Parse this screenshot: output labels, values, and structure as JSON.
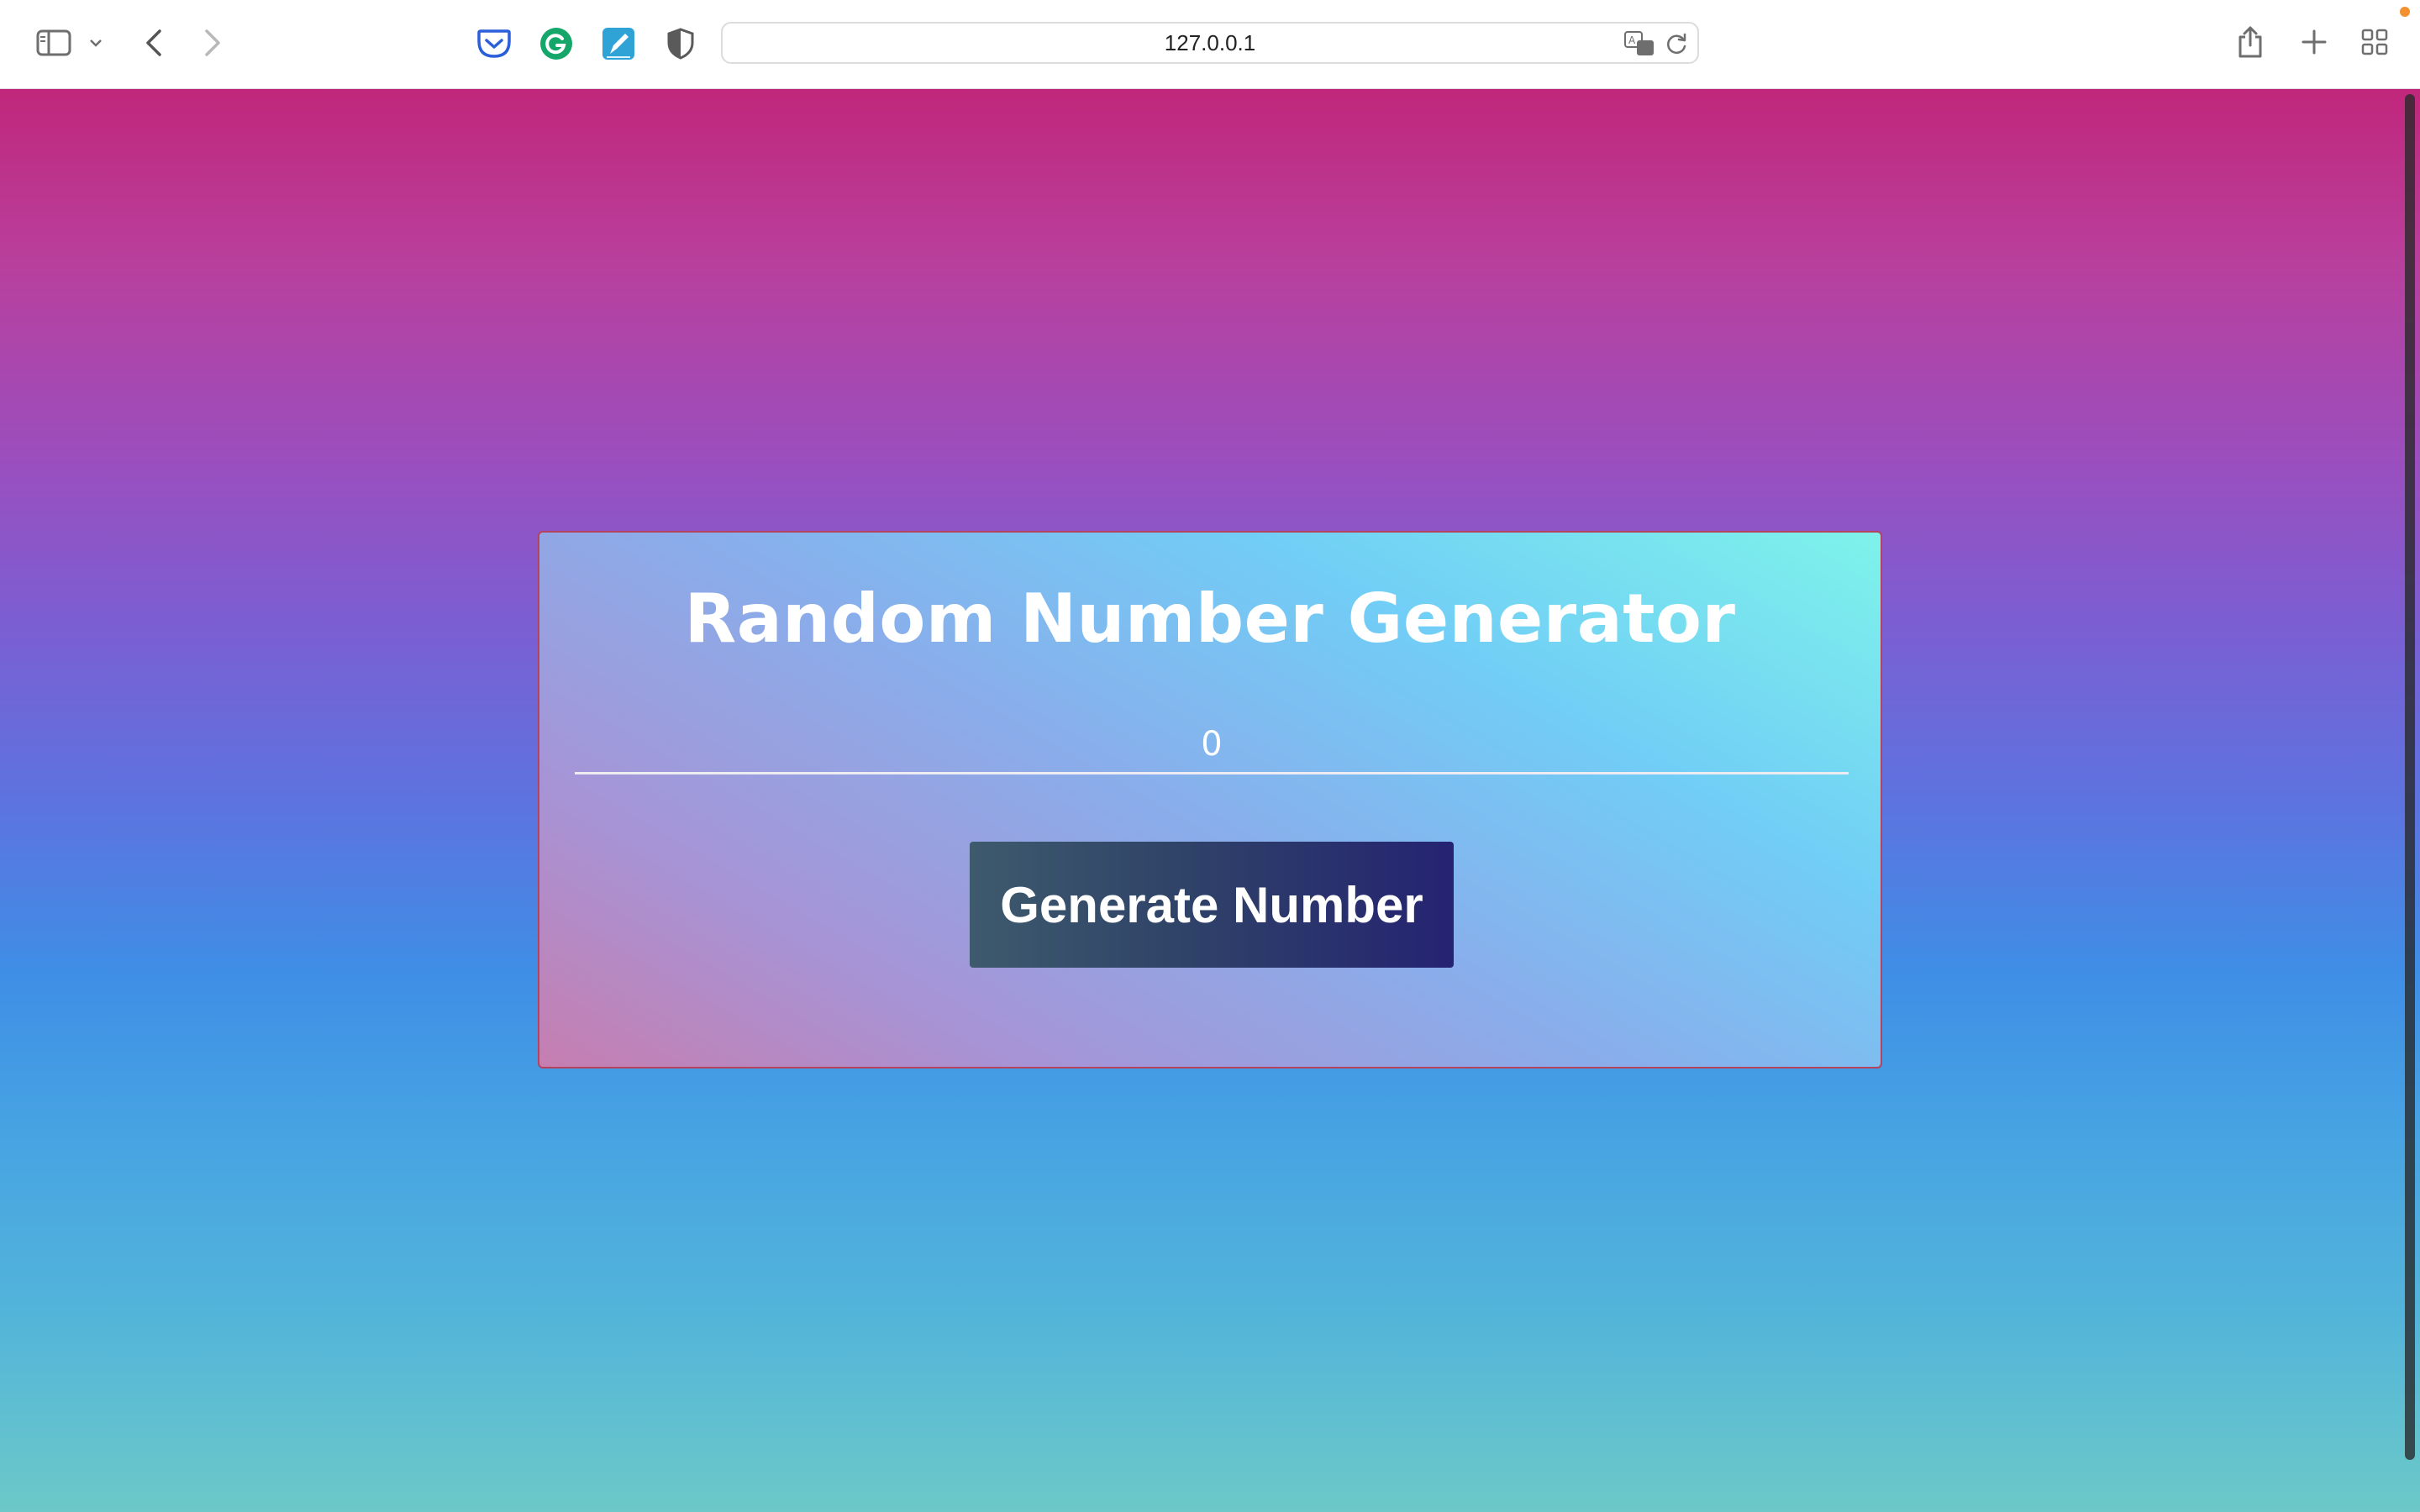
{
  "browser": {
    "url": "127.0.0.1",
    "extensions": [
      "pocket-icon",
      "grammarly-icon",
      "pen-icon",
      "shield-icon"
    ],
    "accent_dot_color": "#f3902f"
  },
  "app": {
    "title": "Random Number Generator",
    "number_value": "0",
    "button_label": "Generate Number"
  },
  "colors": {
    "page_gradient_top": "#c0277b",
    "page_gradient_bottom": "#6cc9c8",
    "card_border": "#b5435e",
    "button_gradient_start": "#3e5a6d",
    "button_gradient_end": "#252372"
  }
}
